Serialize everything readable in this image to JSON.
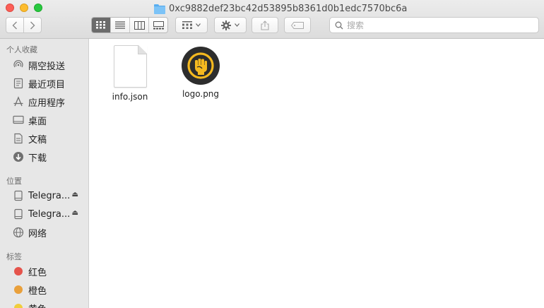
{
  "window": {
    "title": "0xc9882def23bc42d53895b8361d0b1edc7570bc6a"
  },
  "toolbar": {
    "search_placeholder": "搜索",
    "active_view": "icon"
  },
  "sidebar": {
    "favorites_header": "个人收藏",
    "favorites": [
      {
        "label": "隔空投送",
        "icon": "airdrop-icon"
      },
      {
        "label": "最近项目",
        "icon": "recents-icon"
      },
      {
        "label": "应用程序",
        "icon": "applications-icon"
      },
      {
        "label": "桌面",
        "icon": "desktop-icon"
      },
      {
        "label": "文稿",
        "icon": "documents-icon"
      },
      {
        "label": "下载",
        "icon": "downloads-icon"
      }
    ],
    "locations_header": "位置",
    "locations": [
      {
        "label": "Telegra...",
        "icon": "disk-icon"
      },
      {
        "label": "Telegra...",
        "icon": "disk-icon"
      },
      {
        "label": "网络",
        "icon": "network-icon"
      }
    ],
    "tags_header": "标签",
    "tags": [
      {
        "label": "红色",
        "color": "#e5534b"
      },
      {
        "label": "橙色",
        "color": "#e9a03b"
      },
      {
        "label": "黄色",
        "color": "#f0cd3c"
      }
    ]
  },
  "files": [
    {
      "name": "info.json",
      "icon": "json-document-icon"
    },
    {
      "name": "logo.png",
      "icon": "fist-logo-icon"
    }
  ],
  "colors": {
    "logo_background": "#2d2d2d",
    "logo_accent": "#f5b91f"
  }
}
